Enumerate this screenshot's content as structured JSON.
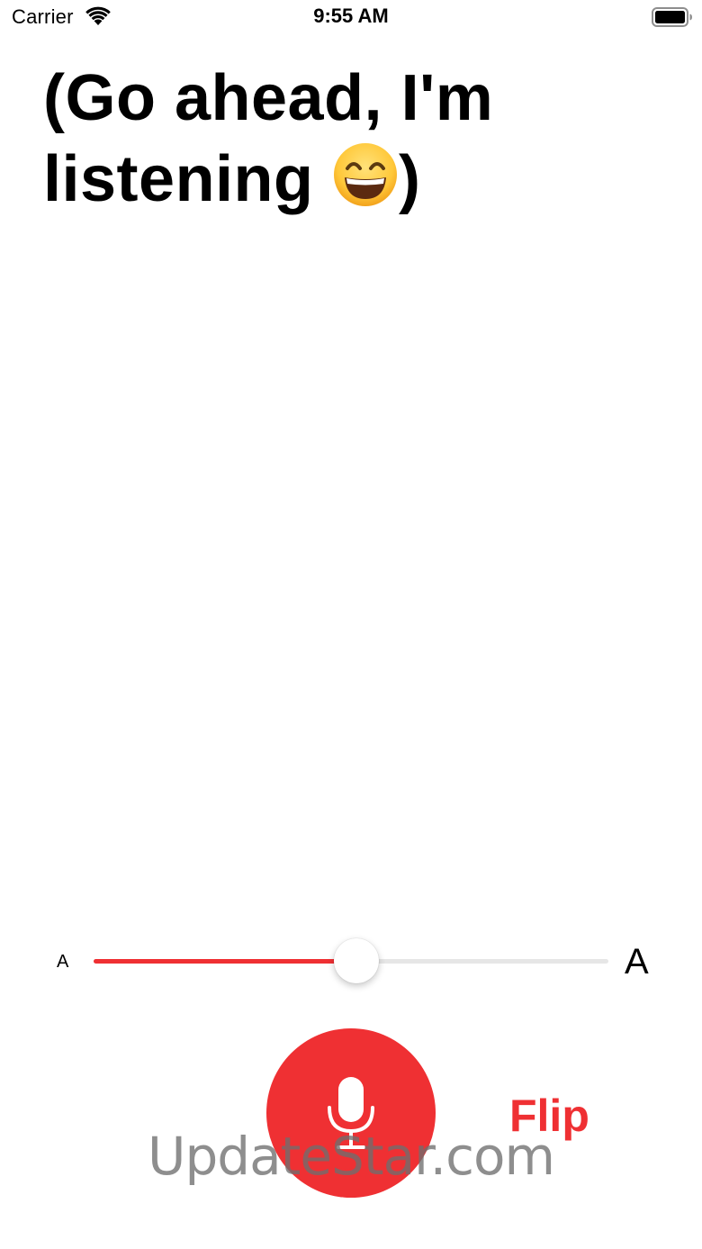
{
  "status_bar": {
    "carrier": "Carrier",
    "time": "9:55 AM",
    "icons": [
      "wifi-icon",
      "battery-icon"
    ]
  },
  "transcript": {
    "text": "(Go ahead, I'm listening ",
    "emoji": "grinning-face-with-smiling-eyes",
    "closing": ")"
  },
  "font_slider": {
    "min_label": "A",
    "max_label": "A",
    "value_fraction": 0.51
  },
  "controls": {
    "mic_icon": "microphone-icon",
    "flip_label": "Flip"
  },
  "watermark": {
    "text": "UpdateStar.com"
  },
  "colors": {
    "accent": "#ef3033",
    "track": "#e6e6e6",
    "background": "#ffffff",
    "text": "#000000"
  }
}
